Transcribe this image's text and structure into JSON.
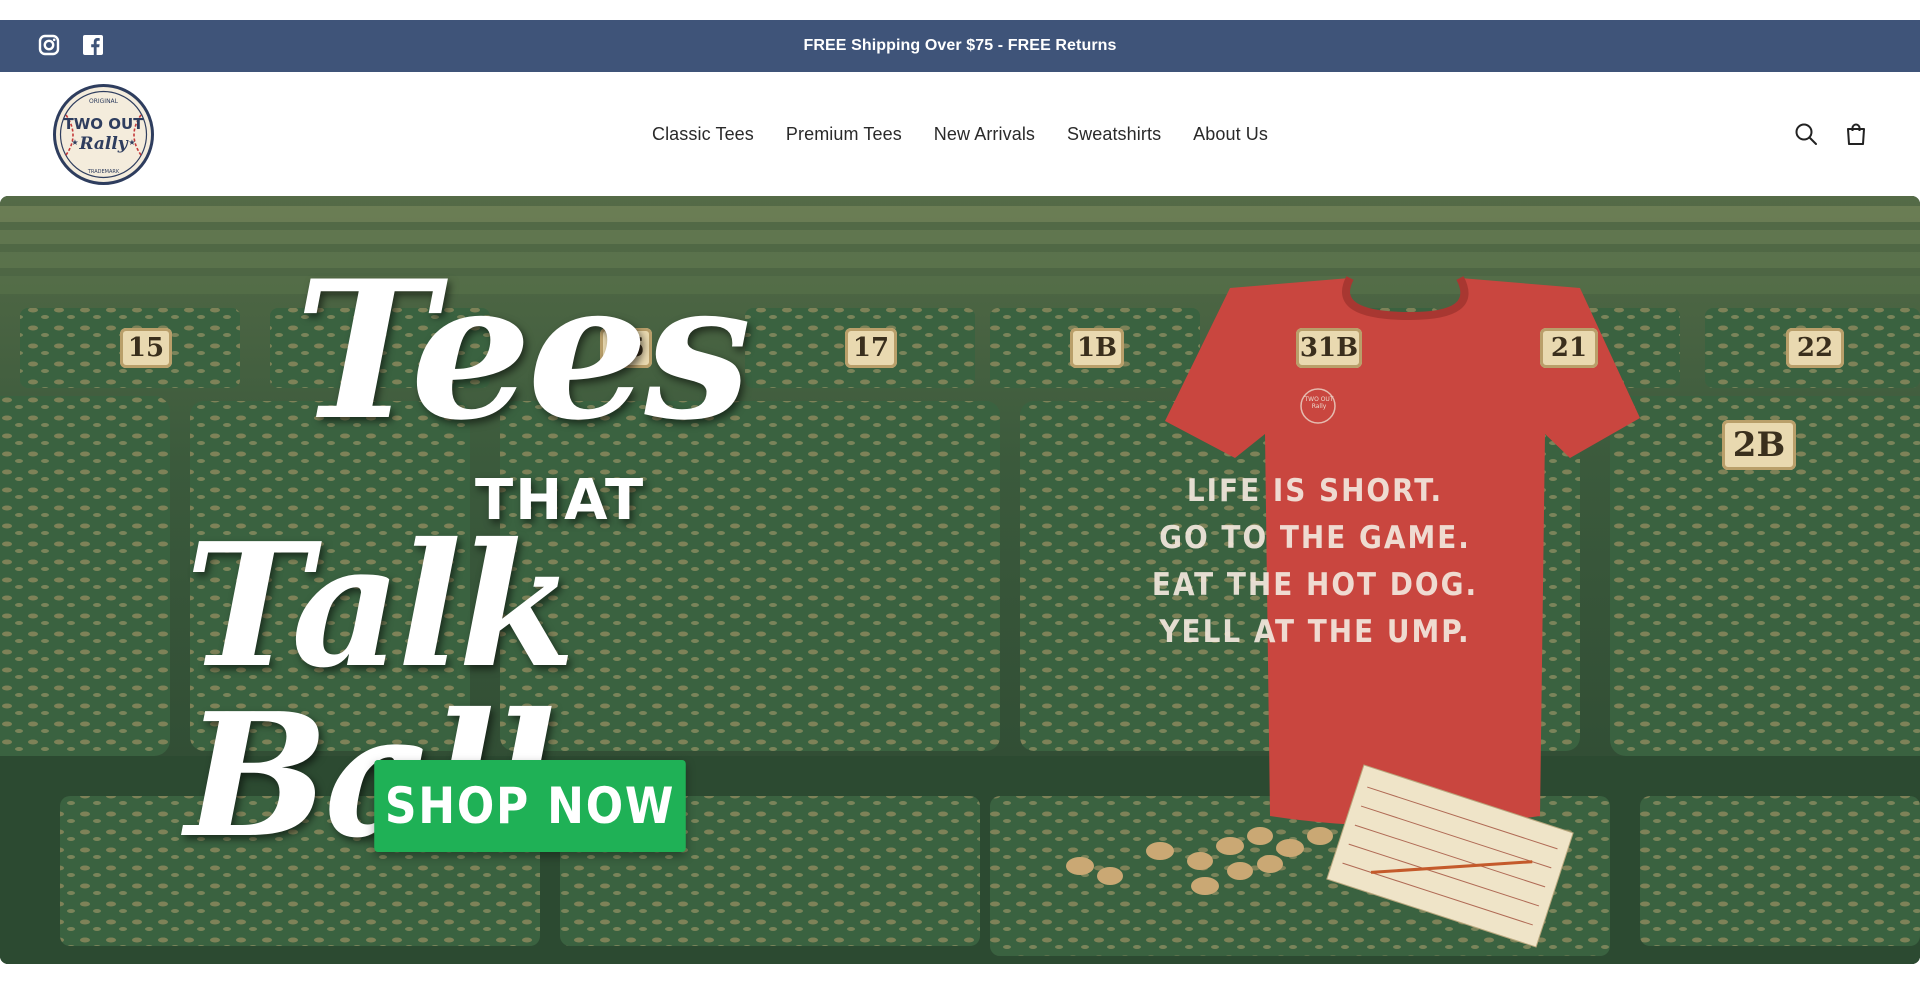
{
  "announcement": {
    "text": "FREE Shipping Over $75 - FREE Returns",
    "socials": [
      "instagram-icon",
      "facebook-icon"
    ]
  },
  "header": {
    "logo": {
      "top": "ORIGINAL",
      "line1": "TWO OUT",
      "line2": "Rally",
      "bottom": "TRADEMARK"
    },
    "nav": [
      "Classic Tees",
      "Premium Tees",
      "New Arrivals",
      "Sweatshirts",
      "About Us"
    ],
    "icons": [
      "search-icon",
      "cart-icon"
    ]
  },
  "hero": {
    "headline": {
      "word1": "Tees",
      "word2": "THAT",
      "word3": "Talk Ball"
    },
    "cta": "SHOP NOW",
    "seat_numbers": [
      "15",
      "16",
      "17",
      "1B",
      "31B",
      "21",
      "22",
      "2B"
    ],
    "shirt_logo": "TWO OUT Rally",
    "shirt_lines": [
      "LIFE IS SHORT.",
      "GO TO THE GAME.",
      "EAT THE HOT DOG.",
      "YELL AT THE UMP."
    ]
  },
  "colors": {
    "announcement_bg": "#3f5479",
    "cta_bg": "#1fb156",
    "shirt": "#c9463f",
    "seat_green": "#2f5a38"
  }
}
